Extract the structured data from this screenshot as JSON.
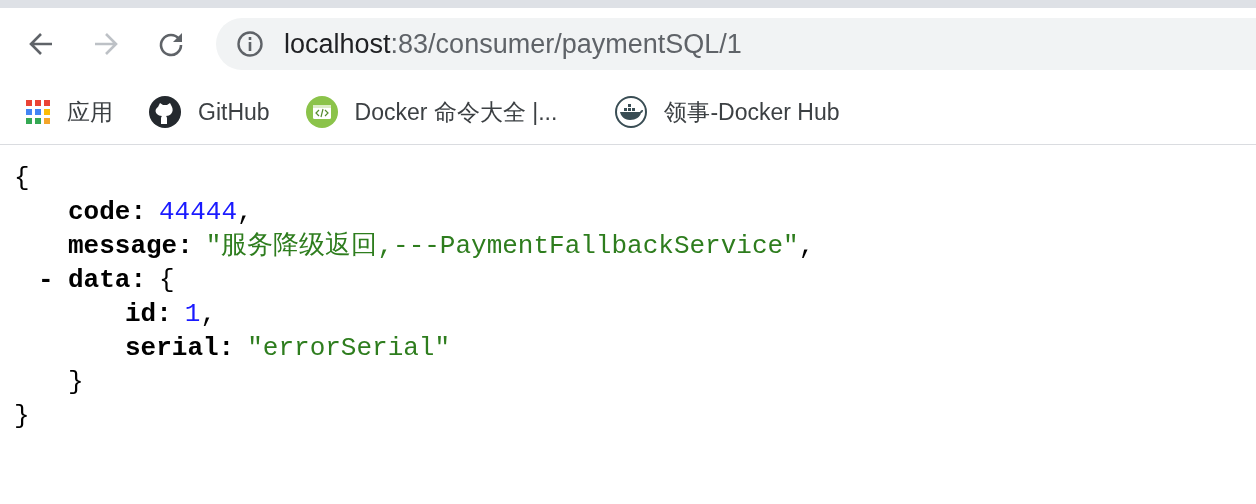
{
  "toolbar": {
    "back": {
      "disabled": false
    },
    "forward": {
      "disabled": true
    },
    "url": {
      "host": "localhost",
      "path": ":83/consumer/paymentSQL/1"
    }
  },
  "bookmarks": [
    {
      "kind": "apps",
      "label": "应用"
    },
    {
      "kind": "github",
      "label": "GitHub"
    },
    {
      "kind": "code",
      "label": "Docker 命令大全 |..."
    },
    {
      "kind": "whale",
      "label": "领事-Docker Hub"
    }
  ],
  "json_view": {
    "open": "{",
    "close": "}",
    "children": [
      {
        "key": "code:",
        "value": "44444",
        "kind": "number",
        "punct": ","
      },
      {
        "key": "message:",
        "value": "\"服务降级返回,---PaymentFallbackService\"",
        "kind": "string",
        "punct": ","
      },
      {
        "toggle": "-",
        "expanded": true,
        "key": "data:",
        "open": "{",
        "close": "}",
        "children": [
          {
            "key": "id:",
            "value": "1",
            "kind": "number",
            "punct": ","
          },
          {
            "key": "serial:",
            "value": "\"errorSerial\"",
            "kind": "string"
          }
        ]
      }
    ]
  }
}
